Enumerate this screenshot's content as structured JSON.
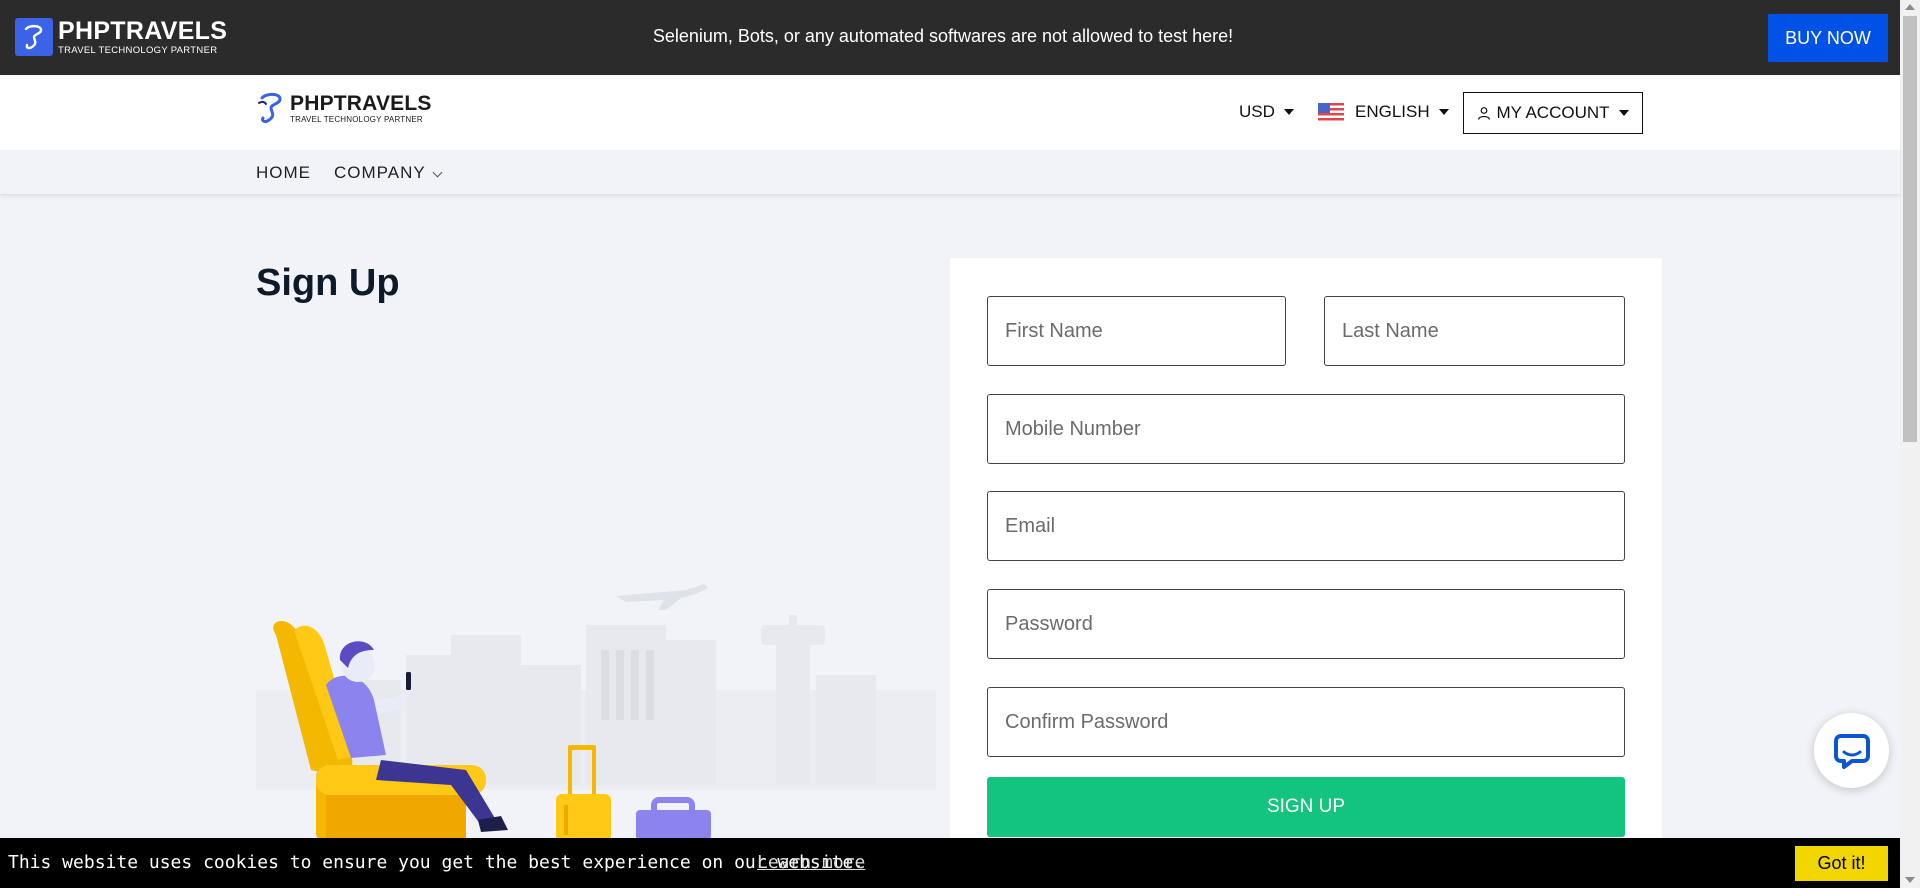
{
  "topbar": {
    "brand_name": "PHPTRAVELS",
    "brand_tagline": "TRAVEL TECHNOLOGY PARTNER",
    "notice": "Selenium, Bots, or any automated softwares are not allowed to test here!",
    "buy_now": "BUY NOW"
  },
  "header": {
    "brand_name": "PHPTRAVELS",
    "brand_tagline": "TRAVEL TECHNOLOGY PARTNER",
    "currency": "USD",
    "language": "ENGLISH",
    "account": "MY ACCOUNT"
  },
  "nav": {
    "home": "HOME",
    "company": "COMPANY"
  },
  "page": {
    "title": "Sign Up"
  },
  "form": {
    "first_name_placeholder": "First Name",
    "last_name_placeholder": "Last Name",
    "mobile_placeholder": "Mobile Number",
    "email_placeholder": "Email",
    "password_placeholder": "Password",
    "confirm_password_placeholder": "Confirm Password",
    "submit": "SIGN UP"
  },
  "cookie": {
    "message": "This website uses cookies to ensure you get the best experience on our website.",
    "learn_more": "Learn more",
    "accept": "Got it!"
  },
  "colors": {
    "brand_blue": "#0051e6",
    "signup_green": "#13c47f",
    "cookie_yellow": "#f1d600"
  }
}
